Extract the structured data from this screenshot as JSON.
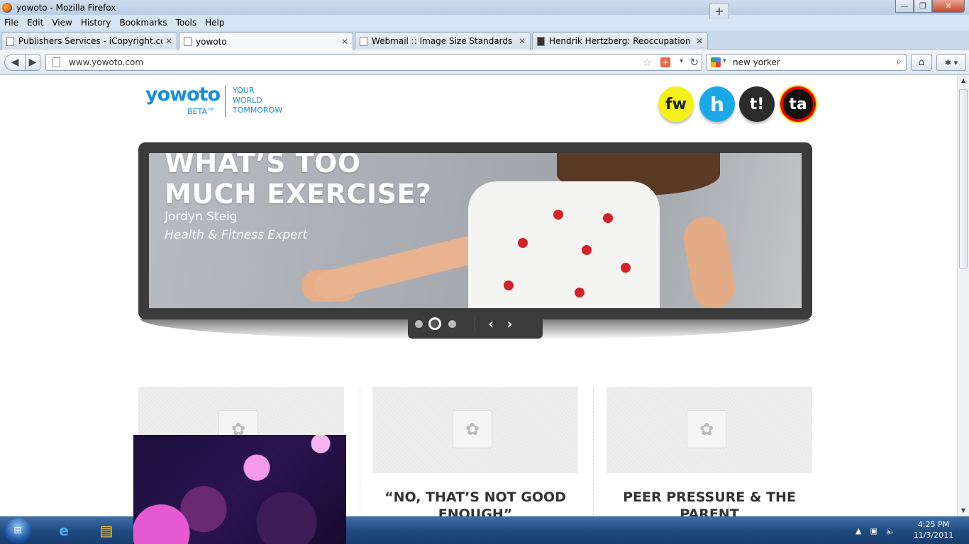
{
  "window": {
    "title": "yowoto - Mozilla Firefox",
    "minimize": "—",
    "maximize": "❐",
    "close": "✕"
  },
  "menu": [
    "File",
    "Edit",
    "View",
    "History",
    "Bookmarks",
    "Tools",
    "Help"
  ],
  "tabs": [
    {
      "label": "Publishers Services - iCopyright.com"
    },
    {
      "label": "yowoto"
    },
    {
      "label": "Webmail :: Image Size Standards"
    },
    {
      "label": "Hendrik Hertzberg: Reoccupation vs. ..."
    }
  ],
  "tab_close": "✕",
  "new_tab": "+",
  "nav": {
    "url": "www.yowoto.com",
    "search": "new yorker"
  },
  "site": {
    "logo": "yowoto",
    "beta": "BETA™",
    "tagline": [
      "YOUR",
      "WORLD",
      "TOMMOROW"
    ],
    "partner_badges": [
      "fw",
      "h",
      "t!",
      "ta"
    ]
  },
  "slide": {
    "title_line1": "WHAT’S TOO",
    "title_line2": "MUCH EXERCISE?",
    "author": "Jordyn Steig",
    "role": "Health & Fitness Expert",
    "current_index": 2,
    "total": 3
  },
  "cards": [
    {
      "title": ""
    },
    {
      "title": "“NO, THAT’S NOT GOOD ENOUGH”"
    },
    {
      "title": "PEER PRESSURE & THE PARENT"
    }
  ],
  "taskbar": {
    "time": "4:25 PM",
    "date": "11/3/2011"
  },
  "colors": {
    "brand": "#1a8fd4",
    "slider_frame": "#3b3b3b"
  }
}
